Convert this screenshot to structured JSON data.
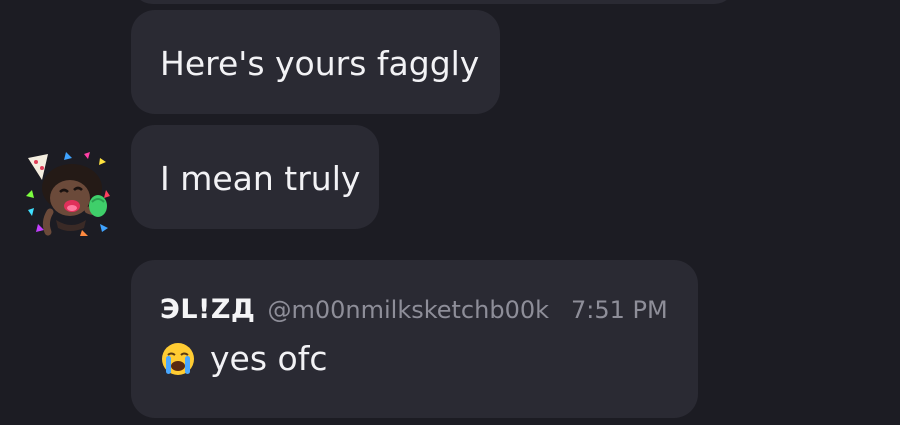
{
  "messages": [
    {
      "text": "Here's yours faggly"
    },
    {
      "text": "I mean truly"
    }
  ],
  "reply": {
    "username": "ЭL!ZД",
    "handle": "@m00nmilksketchb00k",
    "time": "7:51 PM",
    "text": "yes ofc",
    "emoji": "loudly-crying-face"
  },
  "colors": {
    "background": "#1c1c23",
    "bubble": "#2a2a33",
    "text": "#f2f2f5",
    "muted": "#8e8e99"
  }
}
